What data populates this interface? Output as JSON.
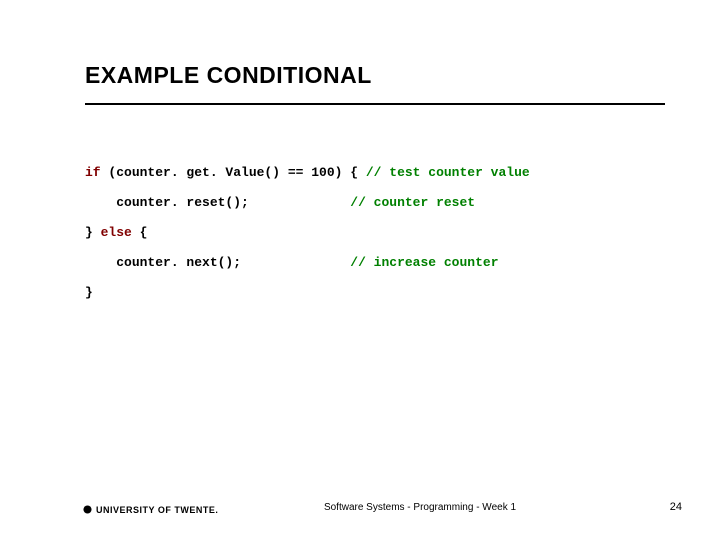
{
  "title": "EXAMPLE CONDITIONAL",
  "code": {
    "l1_kw": "if",
    "l1_rest": " (counter. get. Value() == 100) { ",
    "l1_com": "// test counter value",
    "l2_indent": "    ",
    "l2_stmt": "counter. reset();             ",
    "l2_com": "// counter reset",
    "l3_close": "} ",
    "l3_kw": "else",
    "l3_open": " {",
    "l4_indent": "    ",
    "l4_stmt": "counter. next();              ",
    "l4_com": "// increase counter",
    "l5": "}"
  },
  "footer": {
    "university": "UNIVERSITY OF TWENTE.",
    "course": "Software Systems - Programming - Week 1",
    "page": "24"
  }
}
